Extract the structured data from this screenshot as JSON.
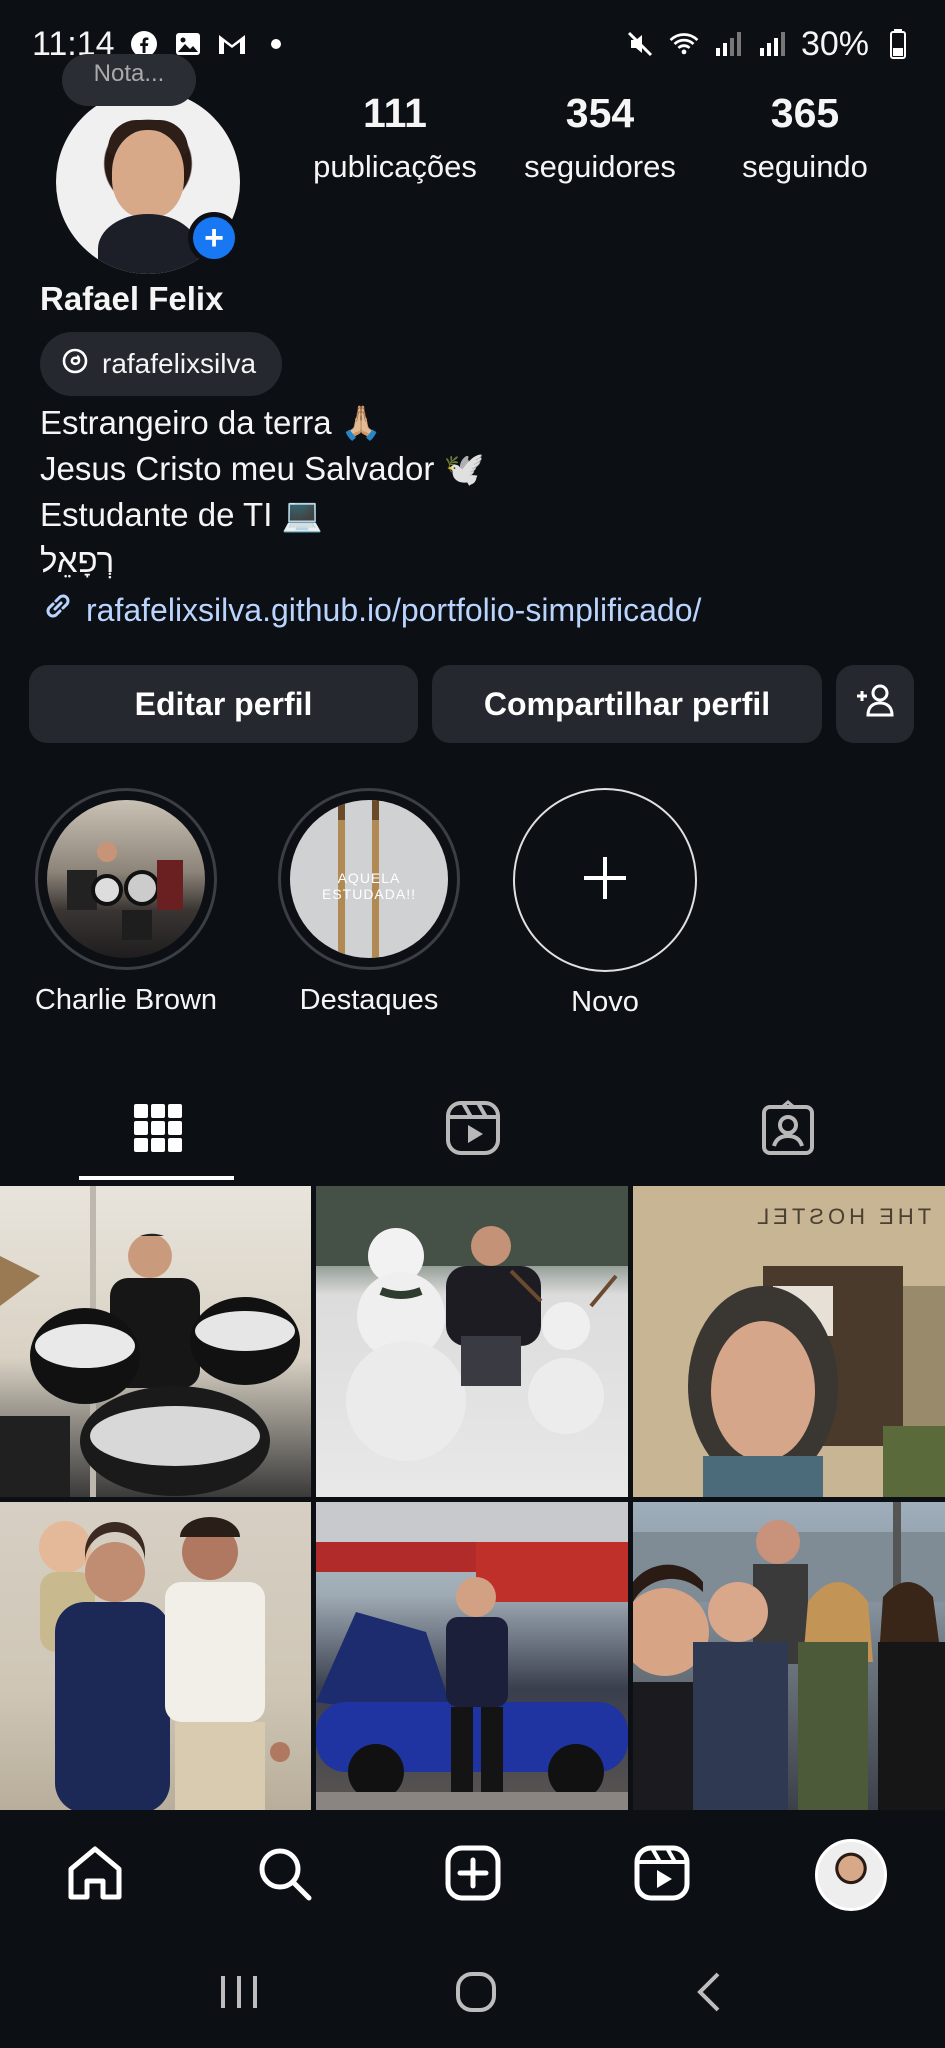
{
  "status_bar": {
    "time": "11:14",
    "battery": "30%"
  },
  "profile": {
    "note_placeholder": "Nota...",
    "name": "Rafael Felix",
    "threads_handle": "rafafelixsilva",
    "stats": [
      {
        "value": "111",
        "label": "publicações"
      },
      {
        "value": "354",
        "label": "seguidores"
      },
      {
        "value": "365",
        "label": "seguindo"
      }
    ],
    "bio_lines": [
      "Estrangeiro da terra 🙏🏼",
      "Jesus Cristo meu Salvador 🕊️",
      "Estudante de TI 💻",
      "רְפָאֵל"
    ],
    "link": "rafafelixsilva.github.io/portfolio-simplificado/"
  },
  "buttons": {
    "edit": "Editar perfil",
    "share": "Compartilhar perfil"
  },
  "highlights": [
    {
      "label": "Charlie Brown"
    },
    {
      "label": "Destaques",
      "overlay_text": "AQUELA ESTUDADA!!"
    },
    {
      "label": "Novo"
    }
  ],
  "tabs": [
    "grid-icon",
    "reels-icon",
    "tagged-icon"
  ],
  "posts": [
    {
      "alt": "drums"
    },
    {
      "alt": "snowman"
    },
    {
      "alt": "the hostel selfie",
      "sign_text": "THE HOSTEL"
    },
    {
      "alt": "family photo"
    },
    {
      "alt": "supercar"
    },
    {
      "alt": "group selfie"
    }
  ],
  "colors": {
    "background": "#0c0f14",
    "button": "#25282e",
    "accent_blue": "#1877f2",
    "link": "#b9d4ff"
  }
}
